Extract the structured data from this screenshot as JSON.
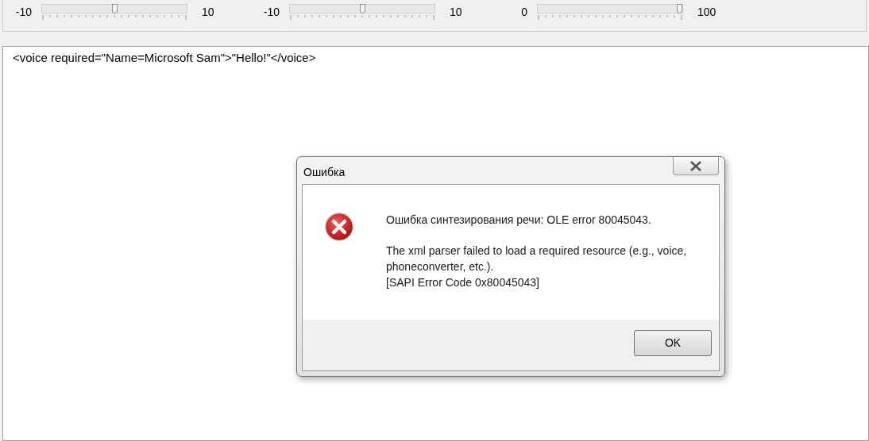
{
  "sliders": [
    {
      "min": "-10",
      "max": "10",
      "level": 0.5
    },
    {
      "min": "-10",
      "max": "10",
      "level": 0.5
    },
    {
      "min": "0",
      "max": "100",
      "level": 1
    }
  ],
  "editor": {
    "text": "<voice required=\"Name=Microsoft Sam\">\"Hello!\"</voice>"
  },
  "dialog": {
    "title": "Ошибка",
    "message_paragraphs": [
      [
        "Ошибка синтезирования речи: OLE error 80045043."
      ],
      [
        "The xml parser failed to load a required resource (e.g., voice,",
        "phoneconverter, etc.).",
        "[SAPI Error Code 0x80045043]"
      ]
    ],
    "buttons": [
      "OK"
    ]
  }
}
